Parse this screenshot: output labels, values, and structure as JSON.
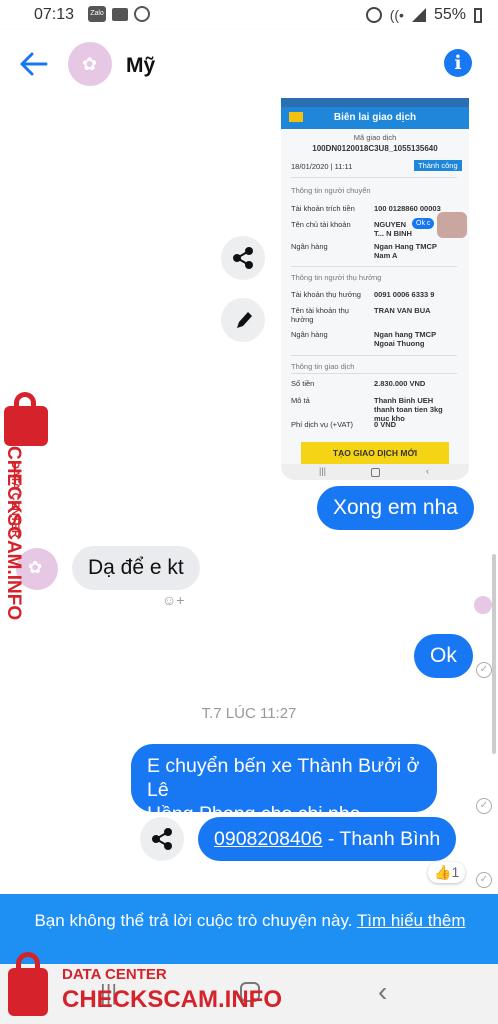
{
  "status_bar": {
    "time": "07:13",
    "battery": "55%"
  },
  "header": {
    "contact_name": "Mỹ"
  },
  "receipt": {
    "title": "Biên lai giao dịch",
    "trans_label": "Mã giao dịch",
    "trans_id": "100DN0120018C3U8_1055135640",
    "date": "18/01/2020 | 11:11",
    "status": "Thành công",
    "sender_section": "Thông tin người chuyển",
    "src_acc_label": "Tài khoản trích tiền",
    "src_acc": "100 0128860 00003",
    "owner_label": "Tên chủ tài khoản",
    "owner": "NGUYEN T... N BINH",
    "bank_label": "Ngân hàng",
    "bank": "Ngan Hang TMCP Nam A",
    "ok_chip": "Ok c",
    "receiver_section": "Thông tin người thụ hưởng",
    "dst_acc_label": "Tài khoản thụ hưởng",
    "dst_acc": "0091 0006 6333 9",
    "dst_name_label": "Tên tài khoản thụ hưởng",
    "dst_name": "TRAN VAN BUA",
    "dst_bank_label": "Ngân hàng",
    "dst_bank": "Ngan hang TMCP Ngoai Thuong",
    "tx_section": "Thông tin giao dịch",
    "amount_label": "Số tiền",
    "amount": "2.830.000 VND",
    "desc_label": "Mô tả",
    "desc": "Thanh Binh UEH thanh toan tien 3kg muc kho",
    "fee_label": "Phí dịch vụ (+VAT)",
    "fee": "0 VND",
    "new_tx_button": "TẠO GIAO DỊCH MỚI"
  },
  "messages": {
    "m1": "Xong em nha",
    "m2": "Dạ để e kt",
    "m3": "Ok",
    "timestamp": "T.7 LÚC 11:27",
    "m4_line1": "E chuyển bến xe Thành Bưởi ở Lê",
    "m4_line2": "Hồng Phong cho chị nha",
    "m5_phone": "0908208406",
    "m5_rest": " - Thanh Bình",
    "reaction_count": "1"
  },
  "bottom_notice": {
    "text": "Bạn không thể trả lời cuộc trò chuyện này.",
    "link": "Tìm hiểu thêm"
  },
  "watermark": {
    "top": "DATA CENTER",
    "brand": "CHECKSCAM.INFO"
  },
  "colors": {
    "messenger_blue": "#1877f2",
    "banner_blue": "#1e90f4",
    "watermark_red": "#d6232b"
  }
}
